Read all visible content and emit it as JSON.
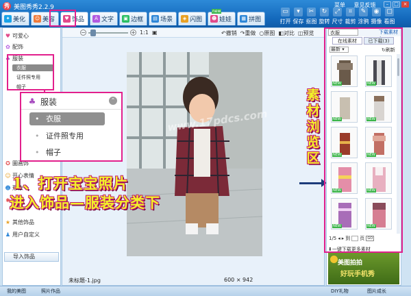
{
  "window": {
    "title": "美图秀秀2.2.9",
    "links": [
      "菜单",
      "意见反馈"
    ]
  },
  "main_tabs": [
    {
      "label": "美化",
      "icon": "magic-icon",
      "color": "#1aa3e8"
    },
    {
      "label": "美容",
      "icon": "face-icon",
      "color": "#f07a3a"
    },
    {
      "label": "饰品",
      "icon": "heart-icon",
      "color": "#e24a8a"
    },
    {
      "label": "文字",
      "icon": "text-icon",
      "color": "#b35be0"
    },
    {
      "label": "边框",
      "icon": "frame-icon",
      "color": "#2bbf63"
    },
    {
      "label": "场景",
      "icon": "scene-icon",
      "color": "#2e87d8"
    },
    {
      "label": "闪图",
      "icon": "flash-icon",
      "color": "#e8a125"
    },
    {
      "label": "娃娃",
      "icon": "doll-icon",
      "color": "#e24a8a"
    },
    {
      "label": "拼图",
      "icon": "puzzle-icon",
      "color": "#2e87d8"
    }
  ],
  "new_flag": "new",
  "tools": [
    {
      "label": "打开",
      "icon": "open-icon"
    },
    {
      "label": "保存",
      "icon": "save-icon"
    },
    {
      "label": "抠图",
      "icon": "cutout-icon"
    },
    {
      "label": "旋转",
      "icon": "rotate-icon"
    },
    {
      "label": "尺寸",
      "icon": "resize-icon"
    },
    {
      "label": "裁剪",
      "icon": "crop-icon"
    },
    {
      "label": "涂鸦",
      "icon": "doodle-icon"
    },
    {
      "label": "摄像",
      "icon": "camera-icon"
    },
    {
      "label": "看图",
      "icon": "view-icon"
    }
  ],
  "sidebar": {
    "items": [
      {
        "label": "可爱心",
        "icon": "heart-icon"
      },
      {
        "label": "配饰",
        "icon": "accessory-icon"
      },
      {
        "label": "服装",
        "icon": "clothing-icon"
      }
    ],
    "sub": [
      "衣服",
      "证件照专用",
      "帽子"
    ],
    "lower": [
      {
        "label": "圖画饰",
        "icon": "brush-icon"
      },
      {
        "label": "开心表情",
        "icon": "smile-icon"
      },
      {
        "label": "形象",
        "icon": "person-icon"
      },
      {
        "label": "节",
        "icon": "gift-icon"
      },
      {
        "label": "其他饰品",
        "icon": "star-icon"
      },
      {
        "label": "用户自定义",
        "icon": "user-icon"
      }
    ],
    "import_label": "导入饰品"
  },
  "canvas": {
    "zoom_labels": [
      "1:1"
    ],
    "actions": [
      "撤销",
      "重做",
      "原图",
      "对比",
      "预览"
    ],
    "watermark": "www.17pdcs.com",
    "file_name": "未标题-1.jpg",
    "image_size": "600 × 942"
  },
  "popup": {
    "title": "服装",
    "items": [
      "衣服",
      "证件照专用",
      "帽子"
    ]
  },
  "captions": {
    "line1": "1、打开宝宝照片",
    "line2": "进入饰品—服装分类下",
    "vertical": [
      "素",
      "材",
      "浏",
      "览",
      "区"
    ]
  },
  "rpanel": {
    "category": "衣服",
    "download_link": "下载素材包",
    "tabs": [
      "在线素材",
      "已下载(3)"
    ],
    "sort": "最新",
    "refresh": "刷新",
    "new_badge": "NEW",
    "page": "1/5",
    "page_to": "到",
    "page_unit": "页",
    "go": "GO",
    "more": "一键下载更多素材",
    "ad_line1": "美图拍拍",
    "ad_line2": "好玩手机秀"
  },
  "bottom": {
    "items": [
      "DIY礼物",
      "图片成长",
      "我的美图",
      "照片作品"
    ]
  },
  "colors": {
    "accent": "#e21f8c",
    "titlebar": "#1368bb",
    "caption": "#f2f229"
  }
}
